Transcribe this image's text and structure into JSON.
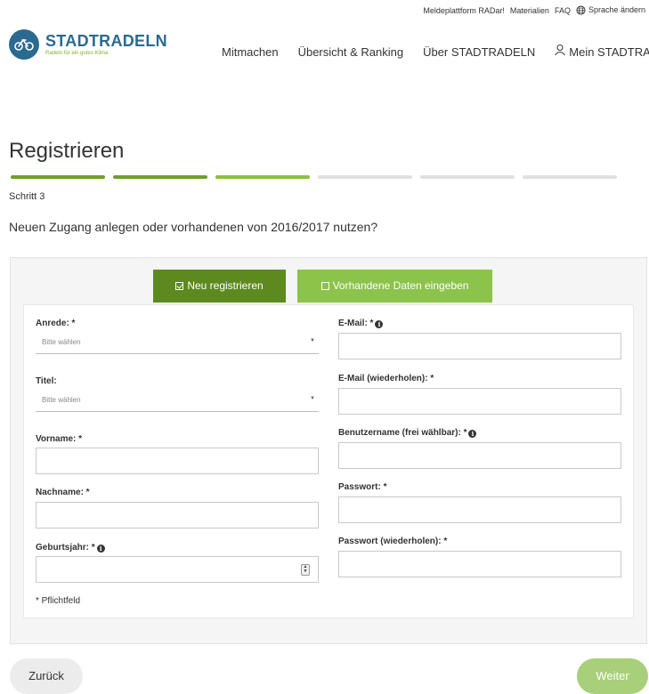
{
  "header": {
    "util_links": [
      "Meldeplattform RADar!",
      "Materialien",
      "FAQ"
    ],
    "language_label": "Sprache ändern",
    "logo_title": "STADTRADELN",
    "logo_subtitle": "Radeln für ein gutes Klima",
    "nav": [
      "Mitmachen",
      "Übersicht & Ranking",
      "Über STADTRADELN"
    ],
    "user_nav": "Mein STADTRADELN"
  },
  "page": {
    "title": "Registrieren",
    "step_label": "Schritt 3",
    "steps_total": 6,
    "steps_completed": 3,
    "question": "Neuen Zugang anlegen oder vorhandenen von 2016/2017 nutzen?"
  },
  "tabs": {
    "new": "Neu registrieren",
    "existing": "Vorhandene Daten eingeben"
  },
  "form": {
    "anrede_label": "Anrede: *",
    "anrede_placeholder": "Bitte wählen",
    "titel_label": "Titel:",
    "titel_placeholder": "Bitte wählen",
    "vorname_label": "Vorname: *",
    "nachname_label": "Nachname: *",
    "geburtsjahr_label": "Geburtsjahr: *",
    "email_label": "E-Mail: *",
    "email_repeat_label": "E-Mail (wiederholen): *",
    "username_label": "Benutzername (frei wählbar): *",
    "password_label": "Passwort: *",
    "password_repeat_label": "Passwort (wiederholen): *",
    "required_note": "* Pflichtfeld"
  },
  "buttons": {
    "back": "Zurück",
    "next": "Weiter"
  },
  "colors": {
    "brand_blue": "#2b6a8f",
    "green_dark": "#5d8a1f",
    "green_light": "#8cc34a",
    "next_button": "#a8cf79"
  }
}
